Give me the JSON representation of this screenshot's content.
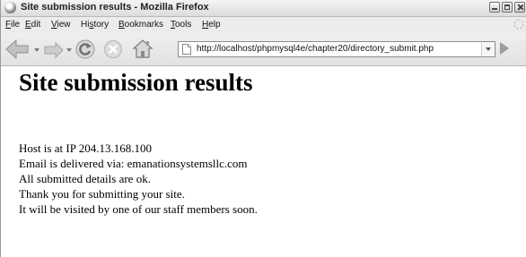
{
  "window": {
    "title": "Site submission results - Mozilla Firefox"
  },
  "menubar": {
    "items": [
      {
        "underline": "F",
        "rest": "ile"
      },
      {
        "underline": "E",
        "rest": "dit"
      },
      {
        "underline": "V",
        "rest": "iew"
      },
      {
        "pre": "Hi",
        "underline": "s",
        "rest": "tory"
      },
      {
        "underline": "B",
        "rest": "ookmarks"
      },
      {
        "underline": "T",
        "rest": "ools"
      },
      {
        "underline": "H",
        "rest": "elp"
      }
    ]
  },
  "navbar": {
    "url": "http://localhost/phpmysql4e/chapter20/directory_submit.php",
    "icons": [
      "back-icon",
      "forward-icon",
      "reload-icon",
      "stop-icon",
      "home-icon",
      "page-icon",
      "go-icon"
    ]
  },
  "page": {
    "heading": "Site submission results",
    "lines": [
      "Host is at IP 204.13.168.100",
      "Email is delivered via: emanationsystemsllc.com",
      "All submitted details are ok.",
      "Thank you for submitting your site.",
      "It will be visited by one of our staff members soon."
    ]
  },
  "colors": {
    "chrome": "#e6e6e6",
    "page_background": "#ffffff",
    "text": "#000000"
  }
}
